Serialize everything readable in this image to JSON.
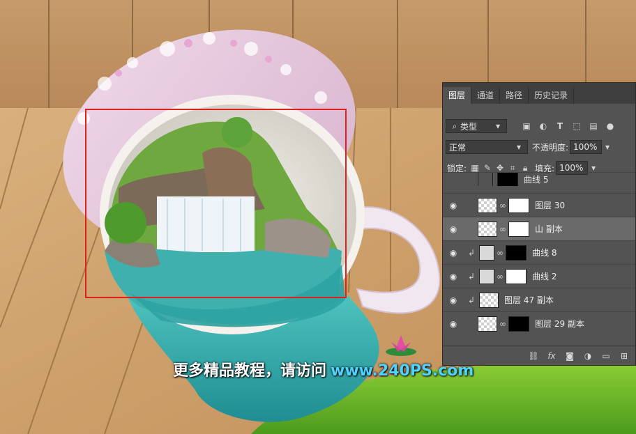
{
  "layers_panel": {
    "tabs": [
      "图层",
      "通道",
      "路径",
      "历史记录"
    ],
    "filter_kind": "类型",
    "blend_mode": "正常",
    "opacity_label": "不透明度:",
    "opacity_value": "100%",
    "lock_label": "锁定:",
    "fill_label": "填充:",
    "fill_value": "100%",
    "layers": [
      {
        "name": "曲线 5"
      },
      {
        "name": "图层 30"
      },
      {
        "name": "山 副本"
      },
      {
        "name": "曲线 8"
      },
      {
        "name": "曲线 2"
      },
      {
        "name": "图层 47 副本"
      },
      {
        "name": "图层 29 副本"
      }
    ],
    "footer_fx": "fx"
  },
  "watermark": {
    "text_cn": "更多精品教程，请访问",
    "url": "www.240PS.com"
  },
  "colors": {
    "selection_rect": "#e0201c",
    "panel_bg": "#535353",
    "url_color": "#4fd3ff"
  }
}
